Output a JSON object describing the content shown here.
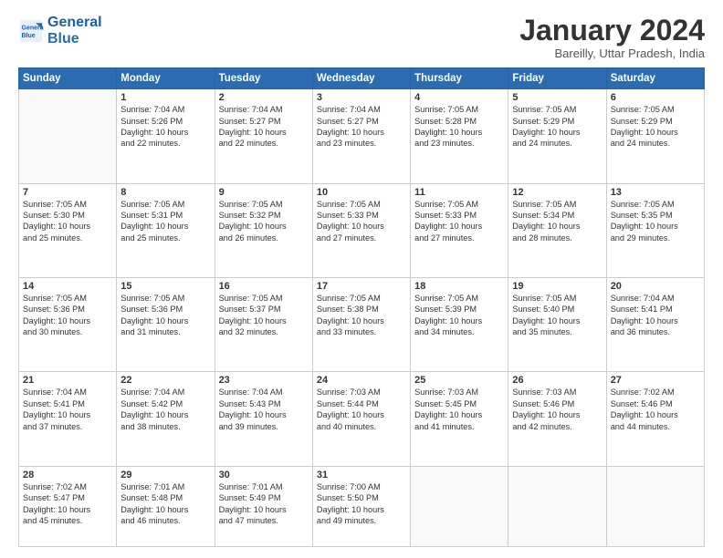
{
  "header": {
    "logo_line1": "General",
    "logo_line2": "Blue",
    "month_title": "January 2024",
    "location": "Bareilly, Uttar Pradesh, India"
  },
  "days_of_week": [
    "Sunday",
    "Monday",
    "Tuesday",
    "Wednesday",
    "Thursday",
    "Friday",
    "Saturday"
  ],
  "weeks": [
    [
      {
        "num": "",
        "text": ""
      },
      {
        "num": "1",
        "text": "Sunrise: 7:04 AM\nSunset: 5:26 PM\nDaylight: 10 hours\nand 22 minutes."
      },
      {
        "num": "2",
        "text": "Sunrise: 7:04 AM\nSunset: 5:27 PM\nDaylight: 10 hours\nand 22 minutes."
      },
      {
        "num": "3",
        "text": "Sunrise: 7:04 AM\nSunset: 5:27 PM\nDaylight: 10 hours\nand 23 minutes."
      },
      {
        "num": "4",
        "text": "Sunrise: 7:05 AM\nSunset: 5:28 PM\nDaylight: 10 hours\nand 23 minutes."
      },
      {
        "num": "5",
        "text": "Sunrise: 7:05 AM\nSunset: 5:29 PM\nDaylight: 10 hours\nand 24 minutes."
      },
      {
        "num": "6",
        "text": "Sunrise: 7:05 AM\nSunset: 5:29 PM\nDaylight: 10 hours\nand 24 minutes."
      }
    ],
    [
      {
        "num": "7",
        "text": "Sunrise: 7:05 AM\nSunset: 5:30 PM\nDaylight: 10 hours\nand 25 minutes."
      },
      {
        "num": "8",
        "text": "Sunrise: 7:05 AM\nSunset: 5:31 PM\nDaylight: 10 hours\nand 25 minutes."
      },
      {
        "num": "9",
        "text": "Sunrise: 7:05 AM\nSunset: 5:32 PM\nDaylight: 10 hours\nand 26 minutes."
      },
      {
        "num": "10",
        "text": "Sunrise: 7:05 AM\nSunset: 5:33 PM\nDaylight: 10 hours\nand 27 minutes."
      },
      {
        "num": "11",
        "text": "Sunrise: 7:05 AM\nSunset: 5:33 PM\nDaylight: 10 hours\nand 27 minutes."
      },
      {
        "num": "12",
        "text": "Sunrise: 7:05 AM\nSunset: 5:34 PM\nDaylight: 10 hours\nand 28 minutes."
      },
      {
        "num": "13",
        "text": "Sunrise: 7:05 AM\nSunset: 5:35 PM\nDaylight: 10 hours\nand 29 minutes."
      }
    ],
    [
      {
        "num": "14",
        "text": "Sunrise: 7:05 AM\nSunset: 5:36 PM\nDaylight: 10 hours\nand 30 minutes."
      },
      {
        "num": "15",
        "text": "Sunrise: 7:05 AM\nSunset: 5:36 PM\nDaylight: 10 hours\nand 31 minutes."
      },
      {
        "num": "16",
        "text": "Sunrise: 7:05 AM\nSunset: 5:37 PM\nDaylight: 10 hours\nand 32 minutes."
      },
      {
        "num": "17",
        "text": "Sunrise: 7:05 AM\nSunset: 5:38 PM\nDaylight: 10 hours\nand 33 minutes."
      },
      {
        "num": "18",
        "text": "Sunrise: 7:05 AM\nSunset: 5:39 PM\nDaylight: 10 hours\nand 34 minutes."
      },
      {
        "num": "19",
        "text": "Sunrise: 7:05 AM\nSunset: 5:40 PM\nDaylight: 10 hours\nand 35 minutes."
      },
      {
        "num": "20",
        "text": "Sunrise: 7:04 AM\nSunset: 5:41 PM\nDaylight: 10 hours\nand 36 minutes."
      }
    ],
    [
      {
        "num": "21",
        "text": "Sunrise: 7:04 AM\nSunset: 5:41 PM\nDaylight: 10 hours\nand 37 minutes."
      },
      {
        "num": "22",
        "text": "Sunrise: 7:04 AM\nSunset: 5:42 PM\nDaylight: 10 hours\nand 38 minutes."
      },
      {
        "num": "23",
        "text": "Sunrise: 7:04 AM\nSunset: 5:43 PM\nDaylight: 10 hours\nand 39 minutes."
      },
      {
        "num": "24",
        "text": "Sunrise: 7:03 AM\nSunset: 5:44 PM\nDaylight: 10 hours\nand 40 minutes."
      },
      {
        "num": "25",
        "text": "Sunrise: 7:03 AM\nSunset: 5:45 PM\nDaylight: 10 hours\nand 41 minutes."
      },
      {
        "num": "26",
        "text": "Sunrise: 7:03 AM\nSunset: 5:46 PM\nDaylight: 10 hours\nand 42 minutes."
      },
      {
        "num": "27",
        "text": "Sunrise: 7:02 AM\nSunset: 5:46 PM\nDaylight: 10 hours\nand 44 minutes."
      }
    ],
    [
      {
        "num": "28",
        "text": "Sunrise: 7:02 AM\nSunset: 5:47 PM\nDaylight: 10 hours\nand 45 minutes."
      },
      {
        "num": "29",
        "text": "Sunrise: 7:01 AM\nSunset: 5:48 PM\nDaylight: 10 hours\nand 46 minutes."
      },
      {
        "num": "30",
        "text": "Sunrise: 7:01 AM\nSunset: 5:49 PM\nDaylight: 10 hours\nand 47 minutes."
      },
      {
        "num": "31",
        "text": "Sunrise: 7:00 AM\nSunset: 5:50 PM\nDaylight: 10 hours\nand 49 minutes."
      },
      {
        "num": "",
        "text": ""
      },
      {
        "num": "",
        "text": ""
      },
      {
        "num": "",
        "text": ""
      }
    ]
  ]
}
